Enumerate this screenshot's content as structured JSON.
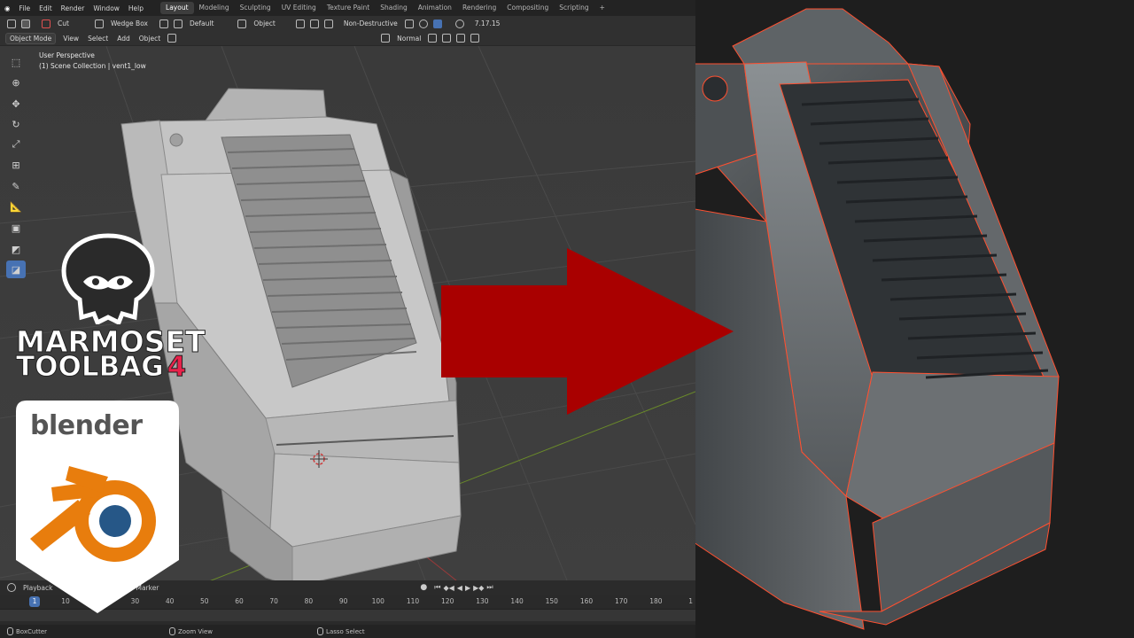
{
  "topbar": {
    "menus": [
      "File",
      "Edit",
      "Render",
      "Window",
      "Help"
    ],
    "workspaces": [
      "Layout",
      "Modeling",
      "Sculpting",
      "UV Editing",
      "Texture Paint",
      "Shading",
      "Animation",
      "Rendering",
      "Compositing",
      "Scripting"
    ],
    "active_workspace": "Layout",
    "add_tab": "+",
    "version": "7.17.15"
  },
  "tool_header": {
    "cut_label": "Cut",
    "shape_label": "Wedge Box",
    "default_label": "Default",
    "object_label": "Object",
    "mode_label": "Non-Destructive"
  },
  "viewport_header": {
    "mode": "Object Mode",
    "menus": [
      "View",
      "Select",
      "Add",
      "Object"
    ],
    "orientation": "Normal"
  },
  "viewport": {
    "perspective": "User Perspective",
    "collection": "(1) Scene Collection | vent1_low"
  },
  "badges": {
    "marmoset_line1": "MARMOSET",
    "marmoset_line2": "TOOLBAG",
    "marmoset_version": "4",
    "blender_word": "blender"
  },
  "timeline": {
    "playback_label": "Playback",
    "marker_label": "Marker",
    "current_frame": "1",
    "ticks": [
      "10",
      "20",
      "30",
      "40",
      "50",
      "60",
      "70",
      "80",
      "90",
      "100",
      "110",
      "120",
      "130",
      "140",
      "150",
      "160",
      "170",
      "180",
      "1"
    ]
  },
  "statusbar": {
    "left": "BoxCutter",
    "middle": "Zoom View",
    "right": "Lasso Select"
  },
  "colors": {
    "accent": "#4772b3",
    "arrow": "#a90000",
    "wire": "#ff5030",
    "marmoset_red": "#e8224b",
    "blender_orange": "#e87d0d",
    "blender_blue": "#265787"
  }
}
